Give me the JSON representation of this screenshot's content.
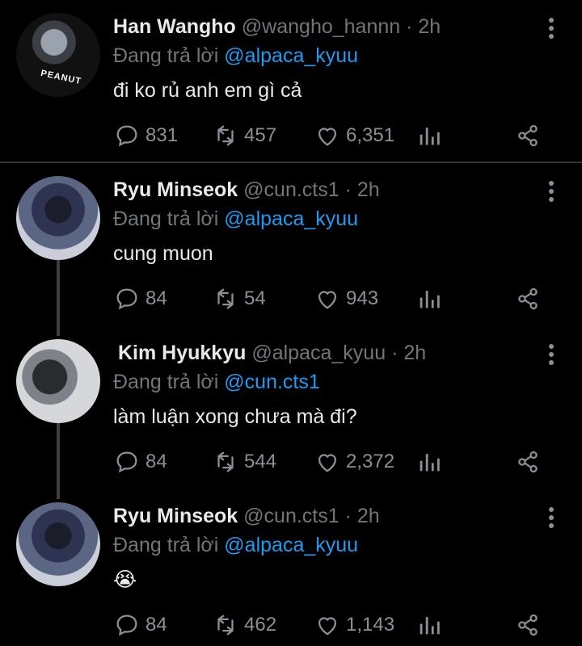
{
  "colors": {
    "background": "#000000",
    "mention": "#1d9bf0",
    "muted": "#71767b",
    "text": "#e7e9ea"
  },
  "tweets": [
    {
      "name": "Han Wangho",
      "handle": "@wangho_hannn",
      "time": "2h",
      "reply_prefix": "Đang trả lời",
      "reply_to": "@alpaca_kyuu",
      "body": "đi ko rủ anh em gì cả",
      "comments": "831",
      "retweets": "457",
      "likes": "6,351",
      "avatar_text": "PEANUT"
    },
    {
      "name": "Ryu Minseok",
      "handle": "@cun.cts1",
      "time": "2h",
      "reply_prefix": "Đang trả lời",
      "reply_to": "@alpaca_kyuu",
      "body": "cung muon",
      "comments": "84",
      "retweets": "54",
      "likes": "943"
    },
    {
      "name": "Kim Hyukkyu",
      "handle": "@alpaca_kyuu",
      "time": "2h",
      "reply_prefix": "Đang trả lời",
      "reply_to": "@cun.cts1",
      "body": "làm luận xong chưa mà đi?",
      "comments": "84",
      "retweets": "544",
      "likes": "2,372"
    },
    {
      "name": "Ryu Minseok",
      "handle": "@cun.cts1",
      "time": "2h",
      "reply_prefix": "Đang trả lời",
      "reply_to": "@alpaca_kyuu",
      "body": "😭",
      "comments": "84",
      "retweets": "462",
      "likes": "1,143"
    }
  ],
  "icons": [
    "comment-icon",
    "retweet-icon",
    "heart-icon",
    "analytics-icon",
    "share-icon",
    "more-options-icon"
  ]
}
